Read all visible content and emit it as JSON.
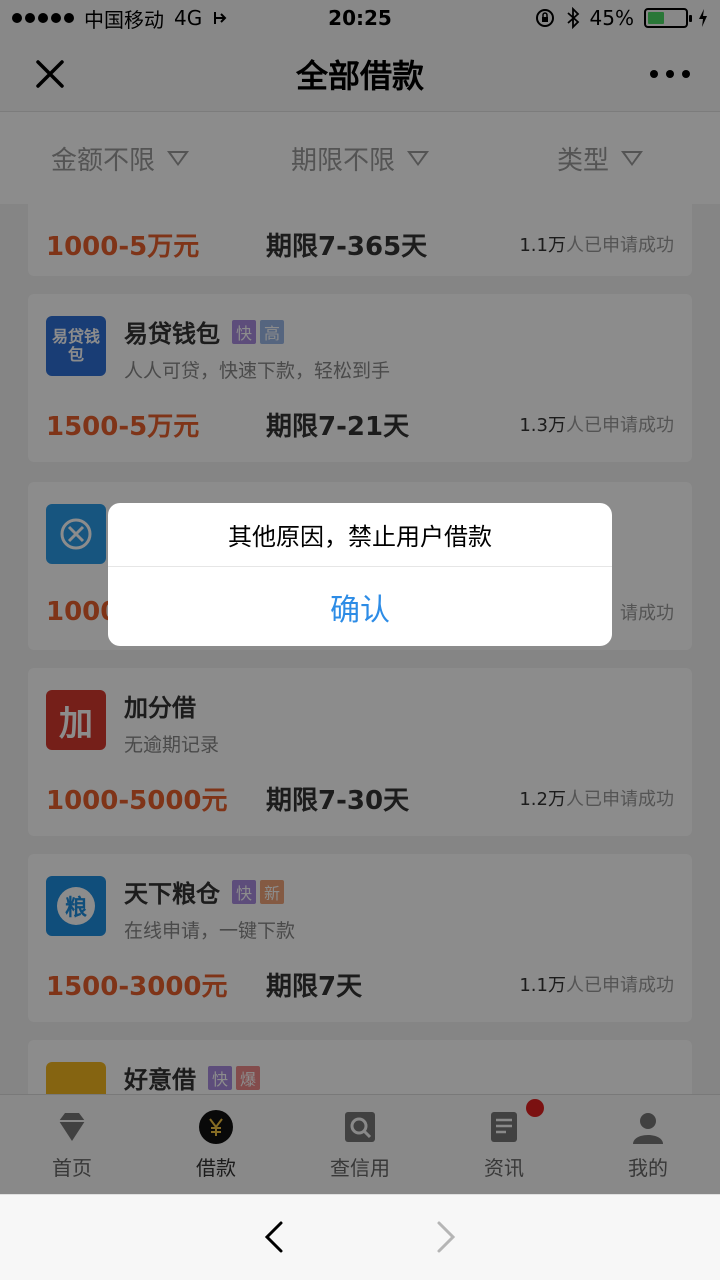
{
  "status_bar": {
    "carrier": "中国移动",
    "network": "4G",
    "time": "20:25",
    "battery_text": "45%",
    "battery_level": 0.45
  },
  "nav": {
    "title": "全部借款"
  },
  "filters": [
    {
      "label": "金额不限"
    },
    {
      "label": "期限不限"
    },
    {
      "label": "类型"
    }
  ],
  "loans": [
    {
      "amount": "1000-5万元",
      "term": "期限7-365天",
      "applied_count": "1.1万",
      "applied_suffix": "人已申请成功"
    },
    {
      "name": "易贷钱包",
      "tags": [
        "快",
        "高"
      ],
      "desc": "人人可贷，快速下款，轻松到手",
      "logo_text": "易贷钱包",
      "amount": "1500-5万元",
      "term": "期限7-21天",
      "applied_count": "1.3万",
      "applied_suffix": "人已申请成功"
    },
    {
      "amount": "1000",
      "applied_suffix": "请成功"
    },
    {
      "name": "加分借",
      "desc": "无逾期记录",
      "logo_text": "加",
      "amount": "1000-5000元",
      "term": "期限7-30天",
      "applied_count": "1.2万",
      "applied_suffix": "人已申请成功"
    },
    {
      "name": "天下粮仓",
      "tags": [
        "快",
        "新"
      ],
      "desc": "在线申请，一键下款",
      "logo_text": "粮",
      "amount": "1500-3000元",
      "term": "期限7天",
      "applied_count": "1.1万",
      "applied_suffix": "人已申请成功"
    },
    {
      "name": "好意借",
      "tags": [
        "快",
        "爆"
      ]
    }
  ],
  "tabs": [
    {
      "label": "首页"
    },
    {
      "label": "借款"
    },
    {
      "label": "查信用"
    },
    {
      "label": "资讯"
    },
    {
      "label": "我的"
    }
  ],
  "dialog": {
    "message": "其他原因，禁止用户借款",
    "confirm_label": "确认"
  },
  "colors": {
    "accent_orange": "#e8602c",
    "dialog_button": "#2d8ce6",
    "battery_green": "#4cd964"
  }
}
